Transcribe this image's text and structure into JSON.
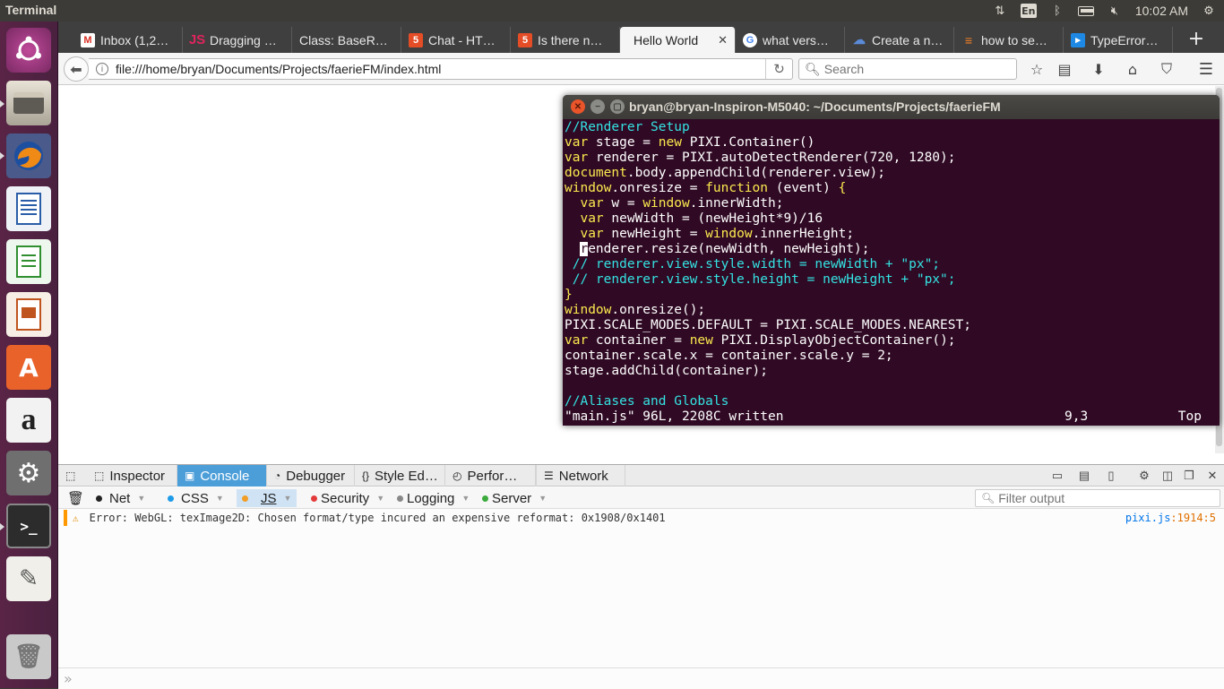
{
  "top_panel": {
    "title": "Terminal",
    "lang": "En",
    "time": "10:02 AM"
  },
  "browser": {
    "tabs": [
      {
        "label": "Inbox (1,2…",
        "favicon": "gmail-icon",
        "color": "#d93025"
      },
      {
        "label": "Dragging …",
        "favicon": "js-icon",
        "color": "#e0245e"
      },
      {
        "label": "Class: BaseR…",
        "favicon": "",
        "color": ""
      },
      {
        "label": "Chat - HT…",
        "favicon": "html5-icon",
        "color": "#e44d26"
      },
      {
        "label": "Is there n…",
        "favicon": "html5-icon",
        "color": "#e44d26"
      },
      {
        "label": "Hello World",
        "favicon": "",
        "color": ""
      },
      {
        "label": "what vers…",
        "favicon": "google-icon",
        "color": "#4285f4"
      },
      {
        "label": "Create a n…",
        "favicon": "cloud-icon",
        "color": "#3b6fc4"
      },
      {
        "label": "how to se…",
        "favicon": "stackoverflow-icon",
        "color": "#f48024"
      },
      {
        "label": "TypeError…",
        "favicon": "devtools-icon",
        "color": "#1e88e5"
      }
    ],
    "url": "file:///home/bryan/Documents/Projects/faerieFM/index.html",
    "search_placeholder": "Search"
  },
  "terminal": {
    "title": "bryan@bryan-Inspiron-M5040: ~/Documents/Projects/faerieFM",
    "status_file": "\"main.js\" 96L, 2208C written",
    "status_pos": "9,3",
    "status_scroll": "Top"
  },
  "devtools": {
    "tabs": [
      "Inspector",
      "Console",
      "Debugger",
      "Style Ed…",
      "Perfor…",
      "Network"
    ],
    "filters": [
      "Net",
      "CSS",
      "JS",
      "Security",
      "Logging",
      "Server"
    ],
    "filter_placeholder": "Filter output",
    "console_message": "Error: WebGL: texImage2D: Chosen format/type incured an expensive reformat: 0x1908/0x1401",
    "console_source_file": "pixi.js",
    "console_source_line": ":1914:5",
    "input_prompt": "»"
  }
}
